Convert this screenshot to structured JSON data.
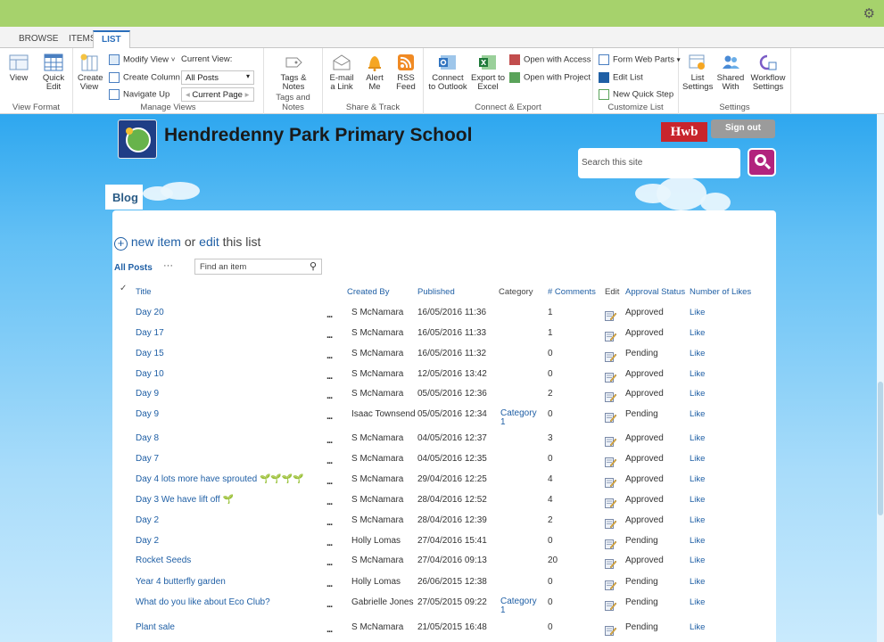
{
  "tabs": [
    "BROWSE",
    "ITEMS",
    "LIST"
  ],
  "ribbon": {
    "view_format": {
      "view": "View",
      "quick_edit": "Quick Edit",
      "label": "View Format"
    },
    "manage_views": {
      "create_view": "Create View",
      "modify_view": "Modify View",
      "create_column": "Create Column",
      "navigate_up": "Navigate Up",
      "current_view_label": "Current View:",
      "current_view_value": "All Posts",
      "current_page": "Current Page",
      "label": "Manage Views"
    },
    "tags": {
      "tags_notes": "Tags & Notes",
      "label": "Tags and Notes"
    },
    "share": {
      "email": "E-mail a Link",
      "alert": "Alert Me",
      "rss": "RSS Feed",
      "label": "Share & Track"
    },
    "connect": {
      "outlook": "Connect to Outlook",
      "excel": "Export to Excel",
      "access": "Open with Access",
      "project": "Open with Project",
      "label": "Connect & Export"
    },
    "customize": {
      "form_web_parts": "Form Web Parts",
      "edit_list": "Edit List",
      "new_quick_step": "New Quick Step",
      "label": "Customize List"
    },
    "settings": {
      "list_settings": "List Settings",
      "shared_with": "Shared With",
      "workflow_settings": "Workflow Settings",
      "label": "Settings"
    }
  },
  "site": {
    "title": "Hendredenny Park Primary School",
    "hwb": "Hwb",
    "sign_out": "Sign out",
    "search_placeholder": "Search this site",
    "nav_blog": "Blog"
  },
  "list": {
    "new_item": "new item",
    "or_text": "or",
    "edit": "edit",
    "this_list": "this list",
    "view_all": "All Posts",
    "find_placeholder": "Find an item",
    "columns": {
      "title": "Title",
      "created_by": "Created By",
      "published": "Published",
      "category": "Category",
      "comments": "# Comments",
      "edit": "Edit",
      "approval": "Approval Status",
      "likes": "Number of Likes"
    },
    "rows": [
      {
        "title": "Day 20",
        "by": "S McNamara",
        "pub": "16/05/2016 11:36",
        "cat": "",
        "com": "1",
        "appr": "Approved",
        "like": "Like"
      },
      {
        "title": "Day 17",
        "by": "S McNamara",
        "pub": "16/05/2016 11:33",
        "cat": "",
        "com": "1",
        "appr": "Approved",
        "like": "Like"
      },
      {
        "title": "Day 15",
        "by": "S McNamara",
        "pub": "16/05/2016 11:32",
        "cat": "",
        "com": "0",
        "appr": "Pending",
        "like": "Like"
      },
      {
        "title": "Day 10",
        "by": "S McNamara",
        "pub": "12/05/2016 13:42",
        "cat": "",
        "com": "0",
        "appr": "Approved",
        "like": "Like"
      },
      {
        "title": "Day 9",
        "by": "S McNamara",
        "pub": "05/05/2016 12:36",
        "cat": "",
        "com": "2",
        "appr": "Approved",
        "like": "Like"
      },
      {
        "title": "Day 9",
        "by": "Isaac Townsend",
        "pub": "05/05/2016 12:34",
        "cat": "Category 1",
        "com": "0",
        "appr": "Pending",
        "like": "Like"
      },
      {
        "title": "Day 8",
        "by": "S McNamara",
        "pub": "04/05/2016 12:37",
        "cat": "",
        "com": "3",
        "appr": "Approved",
        "like": "Like"
      },
      {
        "title": "Day 7",
        "by": "S McNamara",
        "pub": "04/05/2016 12:35",
        "cat": "",
        "com": "0",
        "appr": "Approved",
        "like": "Like"
      },
      {
        "title": "Day 4 lots more have sprouted 🌱🌱🌱🌱",
        "by": "S McNamara",
        "pub": "29/04/2016 12:25",
        "cat": "",
        "com": "4",
        "appr": "Approved",
        "like": "Like"
      },
      {
        "title": "Day 3 We have lift off 🌱",
        "by": "S McNamara",
        "pub": "28/04/2016 12:52",
        "cat": "",
        "com": "4",
        "appr": "Approved",
        "like": "Like"
      },
      {
        "title": "Day 2",
        "by": "S McNamara",
        "pub": "28/04/2016 12:39",
        "cat": "",
        "com": "2",
        "appr": "Approved",
        "like": "Like"
      },
      {
        "title": "Day 2",
        "by": "Holly Lomas",
        "pub": "27/04/2016 15:41",
        "cat": "",
        "com": "0",
        "appr": "Pending",
        "like": "Like"
      },
      {
        "title": "Rocket Seeds",
        "by": "S McNamara",
        "pub": "27/04/2016 09:13",
        "cat": "",
        "com": "20",
        "appr": "Approved",
        "like": "Like"
      },
      {
        "title": "Year 4 butterfly garden",
        "by": "Holly Lomas",
        "pub": "26/06/2015 12:38",
        "cat": "",
        "com": "0",
        "appr": "Pending",
        "like": "Like"
      },
      {
        "title": "What do you like about Eco Club?",
        "by": "Gabrielle Jones",
        "pub": "27/05/2015 09:22",
        "cat": "Category 1",
        "com": "0",
        "appr": "Pending",
        "like": "Like"
      },
      {
        "title": "Plant sale",
        "by": "S McNamara",
        "pub": "21/05/2015 16:48",
        "cat": "",
        "com": "0",
        "appr": "Pending",
        "like": "Like"
      }
    ]
  },
  "colors": {
    "suitebar": "#a6d26c",
    "accent": "#2a6ebb",
    "link": "#1f5fa5",
    "hwb": "#c8252c",
    "search_button": "#b2237d"
  }
}
